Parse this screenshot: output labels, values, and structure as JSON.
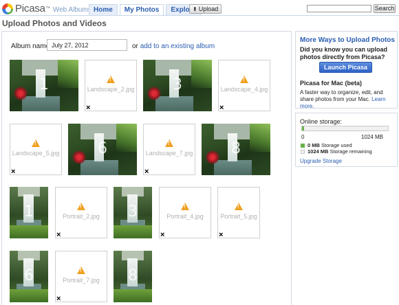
{
  "header": {
    "logo_text": "Picasa",
    "logo_tm": "™",
    "logo_subtitle": "Web Albums",
    "tabs": [
      {
        "label": "Home"
      },
      {
        "label": "My Photos"
      },
      {
        "label": "Explore"
      }
    ],
    "upload_label": "Upload",
    "search_button": "Search",
    "search_value": ""
  },
  "page_title": "Upload Photos and Videos",
  "album": {
    "label": "Album name:",
    "value": "July 27, 2012",
    "or_text": "or",
    "link_text": "add to an existing album"
  },
  "uploads": [
    {
      "kind": "photo",
      "orientation": "landscape",
      "number": "1"
    },
    {
      "kind": "pending",
      "filename": "Landscape_2.jpg"
    },
    {
      "kind": "photo",
      "orientation": "landscape",
      "number": "3"
    },
    {
      "kind": "pending",
      "filename": "Landscape_4.jpg"
    },
    {
      "kind": "pending",
      "filename": "Landscape_5.jpg"
    },
    {
      "kind": "photo",
      "orientation": "landscape",
      "number": "6"
    },
    {
      "kind": "pending",
      "filename": "Landscape_7.jpg"
    },
    {
      "kind": "photo",
      "orientation": "landscape",
      "number": "8"
    },
    {
      "kind": "photo",
      "orientation": "portrait",
      "number": "1"
    },
    {
      "kind": "pending",
      "filename": "Portrait_2.jpg"
    },
    {
      "kind": "photo",
      "orientation": "portrait",
      "number": "3"
    },
    {
      "kind": "pending",
      "filename": "Portrait_4.jpg"
    },
    {
      "kind": "pending",
      "filename": "Portrait_5.jpg"
    },
    {
      "kind": "photo",
      "orientation": "portrait",
      "number": "6"
    },
    {
      "kind": "pending",
      "filename": "Portrait_7.jpg"
    },
    {
      "kind": "photo",
      "orientation": "portrait",
      "number": "8"
    }
  ],
  "sidebar": {
    "more_ways": {
      "heading": "More Ways to Upload Photos",
      "question": "Did you know you can upload photos directly from Picasa?",
      "launch_button": "Launch Picasa",
      "mac_heading": "Picasa for Mac (beta)",
      "mac_desc": "A faster way to organize, edit, and share photos from your Mac.",
      "learn_more": "Learn more."
    },
    "storage": {
      "heading": "Online storage:",
      "min_label": "0",
      "max_label": "1024 MB",
      "used_fraction": 0.02,
      "used_amount": "0 MB",
      "used_label": "Storage used",
      "remaining_amount": "1024 MB",
      "remaining_label": "Storage remaining",
      "upgrade_link": "Upgrade Storage",
      "used_color": "#67b34a"
    }
  },
  "colors": {
    "link": "#2a5db0",
    "warning": "#f0a020"
  }
}
